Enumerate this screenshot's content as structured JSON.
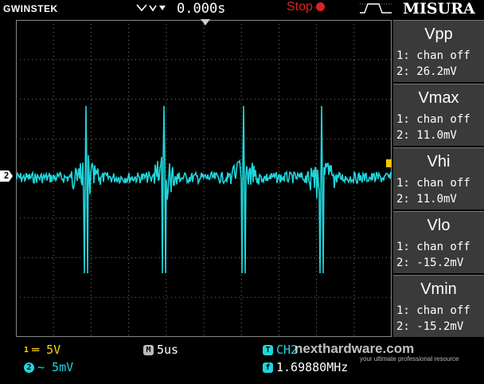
{
  "topbar": {
    "brand": "GWINSTEK",
    "trigger_icon": "trigger-arrow-icon",
    "time_position": "0.000s",
    "run_state": "Stop",
    "edge_icon": "rising-edge-icon",
    "overlay_title": "MISURA"
  },
  "screen": {
    "channel_marker": "2",
    "trace_color": "#1ed6dc"
  },
  "measurements": [
    {
      "title": "Vpp",
      "ch1": "1: chan off",
      "ch2": "2: 26.2mV"
    },
    {
      "title": "Vmax",
      "ch1": "1: chan off",
      "ch2": "2: 11.0mV"
    },
    {
      "title": "Vhi",
      "ch1": "1: chan off",
      "ch2": "2: 11.0mV"
    },
    {
      "title": "Vlo",
      "ch1": "1: chan off",
      "ch2": "2: -15.2mV"
    },
    {
      "title": "Vmin",
      "ch1": "1: chan off",
      "ch2": "2: -15.2mV"
    }
  ],
  "bottom": {
    "ch1_num": "1",
    "ch1_scale": "═ 5V",
    "ch2_num": "2",
    "ch2_scale": "~ 5mV",
    "timebase_icon": "M",
    "timebase": "5us",
    "trigger_src_icon": "T",
    "trigger_src": "CH2",
    "freq_icon": "f",
    "frequency": "1.69880MHz"
  },
  "watermark": {
    "text": "nexthardware.com",
    "sub": "your ultimate professional resource"
  },
  "colors": {
    "ch1": "#ffd400",
    "ch2": "#1ed6dc",
    "stop": "#e02020"
  }
}
